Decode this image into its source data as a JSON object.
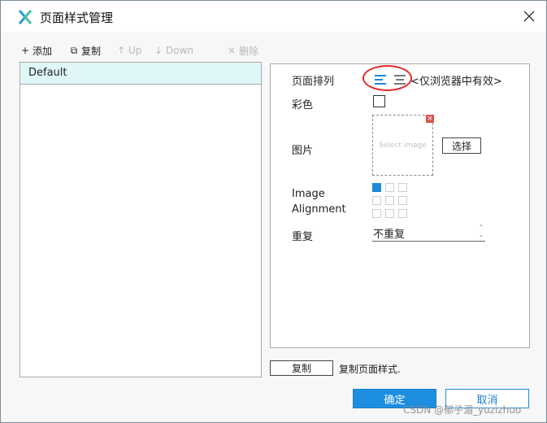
{
  "window": {
    "title": "页面样式管理",
    "accent_color": "#1e8fe0"
  },
  "toolbar": {
    "add_label": "添加",
    "copy_label": "复制",
    "up_label": "Up",
    "down_label": "Down",
    "delete_label": "删除"
  },
  "styles_list": {
    "items": [
      "Default"
    ],
    "selected": "Default"
  },
  "properties": {
    "page_align_label": "页面排列",
    "page_align_note": "<仅浏览器中有效>",
    "color_label": "彩色",
    "color_checked": false,
    "image_label": "图片",
    "image_placeholder": "Select image",
    "select_button": "选择",
    "image_alignment_label_1": "Image",
    "image_alignment_label_2": "Alignment",
    "image_alignment_selected": "top-left",
    "repeat_label": "重复",
    "repeat_value": "不重复"
  },
  "footer": {
    "copy_button": "复制",
    "copy_desc": "复制页面样式.",
    "ok_button": "确定",
    "cancel_button": "取消"
  },
  "watermark": "CSDN @郁子湄_yuzizhuo"
}
